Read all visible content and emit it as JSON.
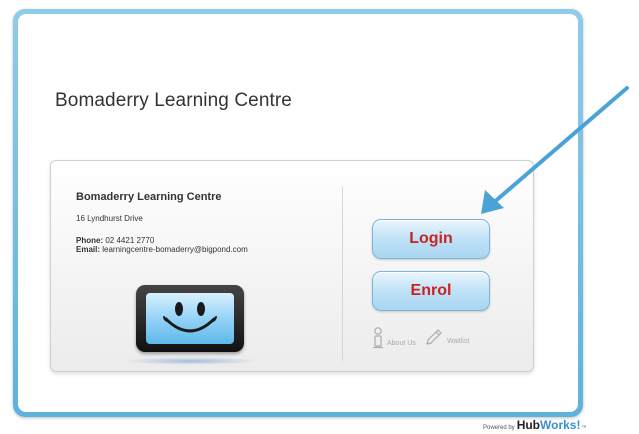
{
  "page": {
    "title": "Bomaderry Learning Centre"
  },
  "card": {
    "org_name": "Bomaderry Learning Centre",
    "address": "16 Lyndhurst Drive",
    "phone_label": "Phone:",
    "phone": "02 4421 2770",
    "email_label": "Email:",
    "email": "learningcentre-bomaderry@bigpond.com"
  },
  "actions": {
    "login_label": "Login",
    "enrol_label": "Enrol",
    "about_label": "About Us",
    "waitlist_label": "Waitlist"
  },
  "footer": {
    "powered_by": "Powered by",
    "brand_hub": "Hub",
    "brand_works": "Works!",
    "trademark": "™"
  },
  "colors": {
    "frame": "#5fb2dc",
    "button_text": "#cc2222",
    "arrow": "#4aa3d6"
  },
  "icons": [
    "smiley-monitor-icon",
    "info-person-icon",
    "pencil-icon",
    "pointer-arrow-icon"
  ]
}
